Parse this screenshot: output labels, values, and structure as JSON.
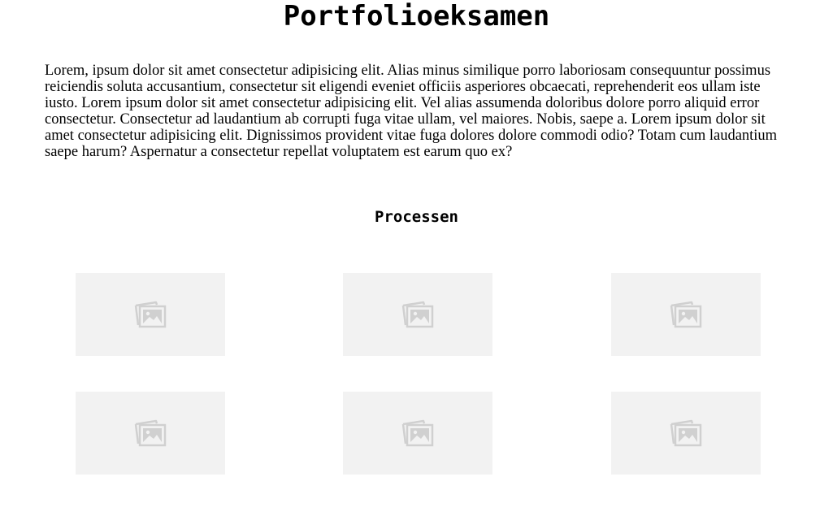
{
  "header": {
    "title": "Portfolioeksamen"
  },
  "intro": {
    "text": "Lorem, ipsum dolor sit amet consectetur adipisicing elit. Alias minus similique porro laboriosam consequuntur possimus reiciendis soluta accusantium, consectetur sit eligendi eveniet officiis asperiores obcaecati, reprehenderit eos ullam iste iusto. Lorem ipsum dolor sit amet consectetur adipisicing elit. Vel alias assumenda doloribus dolore porro aliquid error consectetur. Consectetur ad laudantium ab corrupti fuga vitae ullam, vel maiores. Nobis, saepe a. Lorem ipsum dolor sit amet consectetur adipisicing elit. Dignissimos provident vitae fuga dolores dolore commodi odio? Totam cum laudantium saepe harum? Aspernatur a consectetur repellat voluptatem est earum quo ex?"
  },
  "process": {
    "heading": "Processen",
    "gallery": {
      "item_count": 6,
      "placeholder_icon": "image-placeholder-icon"
    }
  },
  "colors": {
    "tile_background": "#f2f2f2",
    "icon_stroke": "#d0d0d0"
  }
}
